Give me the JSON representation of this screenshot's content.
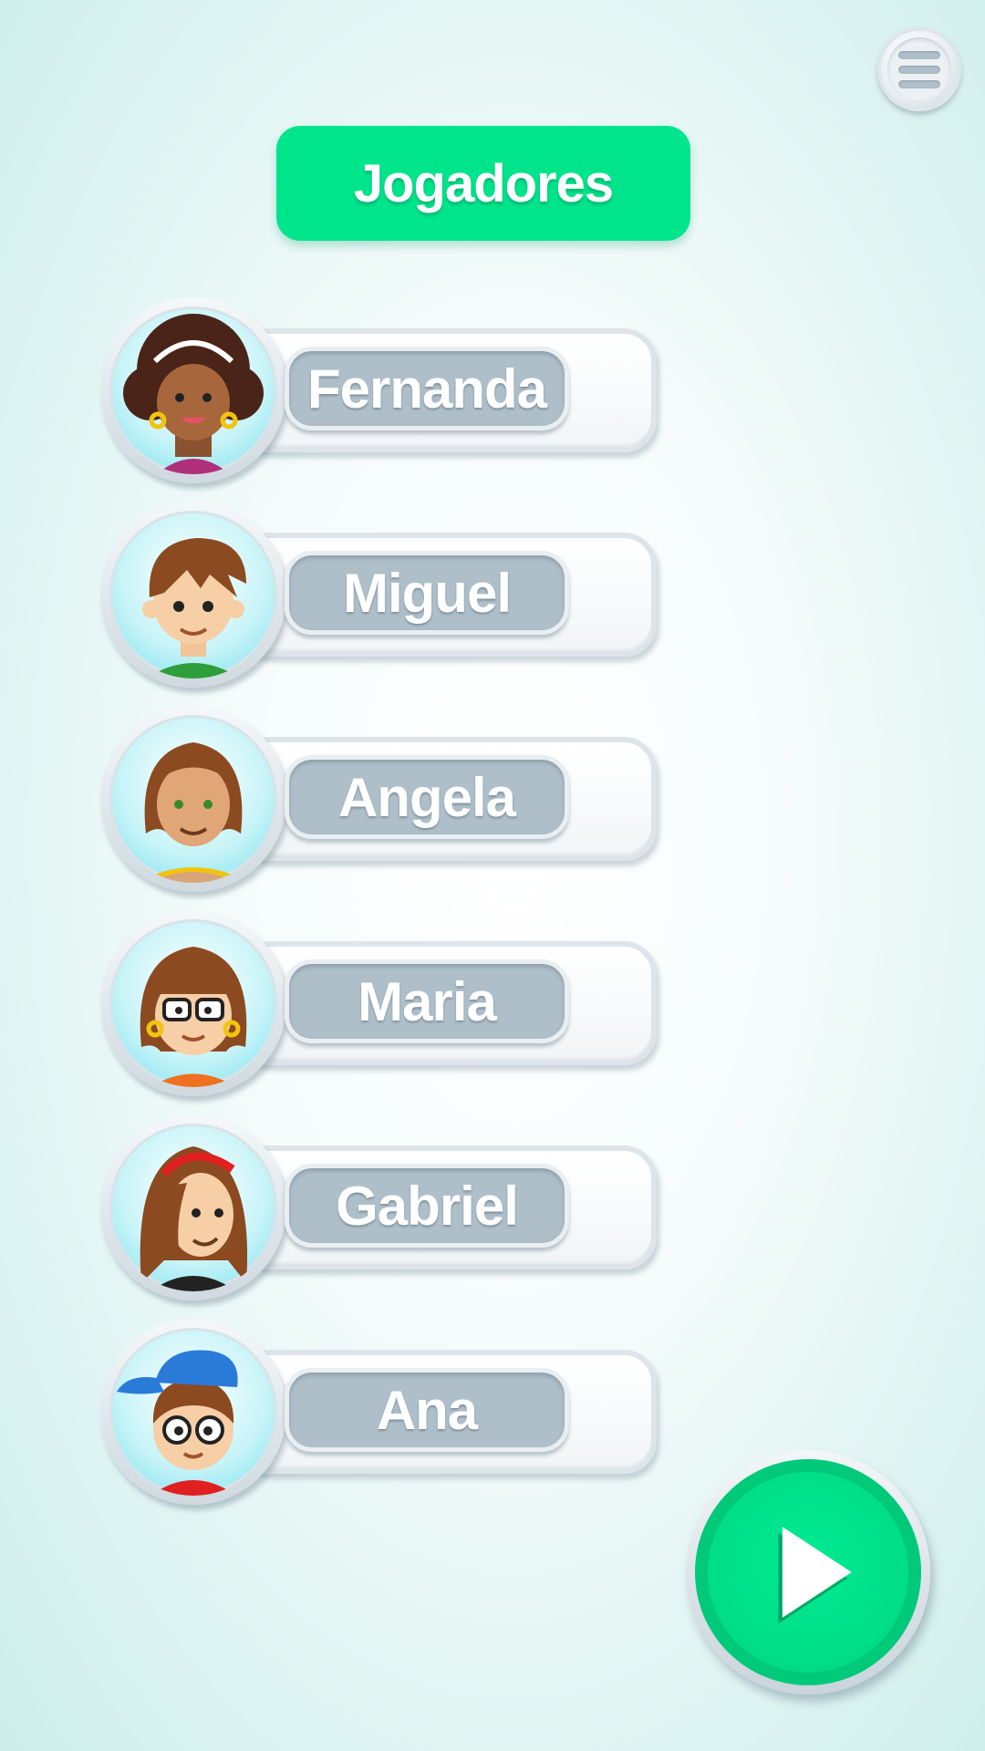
{
  "header": {
    "menu_icon": "hamburger-menu-icon",
    "title": "Jogadores"
  },
  "players": [
    {
      "name": "Fernanda",
      "avatar": "girl-curly-hair-avatar"
    },
    {
      "name": "Miguel",
      "avatar": "boy-spiky-hair-avatar"
    },
    {
      "name": "Angela",
      "avatar": "woman-wavy-hair-avatar"
    },
    {
      "name": "Maria",
      "avatar": "girl-glasses-avatar"
    },
    {
      "name": "Gabriel",
      "avatar": "long-hair-headband-avatar"
    },
    {
      "name": "Ana",
      "avatar": "boy-cap-glasses-avatar"
    }
  ],
  "play_button": {
    "icon": "play-icon"
  },
  "colors": {
    "accent_green": "#00e58c",
    "name_pill": "#aebfc9",
    "avatar_bg": "#c8f4f8"
  }
}
